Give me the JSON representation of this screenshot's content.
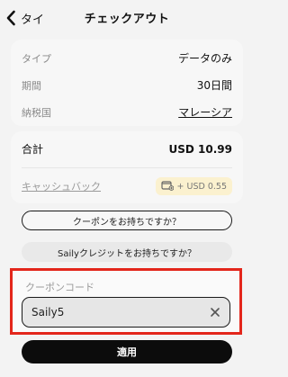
{
  "header": {
    "back_label": "タイ",
    "title": "チェックアウト"
  },
  "details": {
    "rows": [
      {
        "label": "タイプ",
        "value": "データのみ"
      },
      {
        "label": "期間",
        "value": "30日間"
      },
      {
        "label": "納税国",
        "value": "マレーシア"
      }
    ]
  },
  "summary": {
    "total_label": "合計",
    "total_value": "USD 10.99",
    "cashback_label": "キャッシュバック",
    "cashback_value": "+ USD 0.55"
  },
  "actions": {
    "coupon_toggle": "クーポンをお持ちですか？",
    "credit_toggle": "Sailyクレジットをお持ちですか？"
  },
  "coupon": {
    "label": "クーポンコード",
    "value": "Saily5"
  },
  "apply_label": "適用",
  "colors": {
    "highlight_border": "#e3261b",
    "cashback_badge_bg": "#fbf1cf",
    "primary_button": "#0c0c0c"
  }
}
